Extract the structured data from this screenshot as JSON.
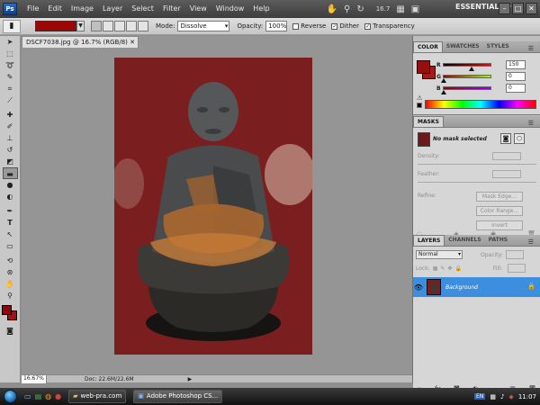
{
  "app": {
    "logo": "Ps",
    "menu": [
      "File",
      "Edit",
      "Image",
      "Layer",
      "Select",
      "Filter",
      "View",
      "Window",
      "Help"
    ],
    "zoom_display": "16.7",
    "workspace": "ESSENTIALS",
    "window_buttons": [
      "–",
      "□",
      "✕"
    ]
  },
  "options_bar": {
    "tool_icon": "gradient-tool-icon",
    "gradient_color": "#9e0606",
    "mode_label": "Mode:",
    "mode_value": "Dissolve",
    "opacity_label": "Opacity:",
    "opacity_value": "100%",
    "reverse_label": "Reverse",
    "reverse_checked": false,
    "dither_label": "Dither",
    "dither_checked": true,
    "transparency_label": "Transparency",
    "transparency_checked": true
  },
  "tools": [
    "move",
    "marquee",
    "lasso",
    "quick-select",
    "crop",
    "eyedropper",
    "spot-heal",
    "brush",
    "clone-stamp",
    "history-brush",
    "eraser",
    "gradient",
    "blur",
    "dodge",
    "pen",
    "type",
    "path-select",
    "shape",
    "3d-rotate",
    "3d-orbit",
    "hand",
    "zoom"
  ],
  "colors": {
    "foreground": "#8e0808",
    "background": "#a41313"
  },
  "document": {
    "tab_title": "DSCF7038.jpg @ 16.7% (RGB/8)",
    "zoom_field": "16.67%",
    "doc_info": "Doc: 22.6M/22.6M",
    "canvas_bg": "#7c1f20"
  },
  "color_panel": {
    "tabs": [
      "COLOR",
      "SWATCHES",
      "STYLES"
    ],
    "active_tab": "COLOR",
    "channels": [
      {
        "name": "R",
        "value": "150",
        "fraction": 0.59
      },
      {
        "name": "G",
        "value": "0",
        "fraction": 0.0
      },
      {
        "name": "B",
        "value": "0",
        "fraction": 0.0
      }
    ]
  },
  "masks_panel": {
    "tabs": [
      "MASKS"
    ],
    "active_tab": "MASKS",
    "status": "No mask selected",
    "density_label": "Density:",
    "feather_label": "Feather:",
    "refine_label": "Refine:",
    "mask_edge": "Mask Edge...",
    "color_range": "Color Range...",
    "invert": "Invert"
  },
  "layers_panel": {
    "tabs": [
      "LAYERS",
      "CHANNELS",
      "PATHS"
    ],
    "active_tab": "LAYERS",
    "blend_mode": "Normal",
    "opacity_label": "Opacity:",
    "lock_label": "Lock:",
    "fill_label": "Fill:",
    "layers": [
      {
        "name": "Background",
        "visible": true,
        "locked": true
      }
    ]
  },
  "taskbar": {
    "tasks": [
      {
        "label": "web-pra.com",
        "active": false
      },
      {
        "label": "Adobe Photoshop CS...",
        "active": true
      }
    ],
    "lang": "EN",
    "clock": "11:07"
  }
}
